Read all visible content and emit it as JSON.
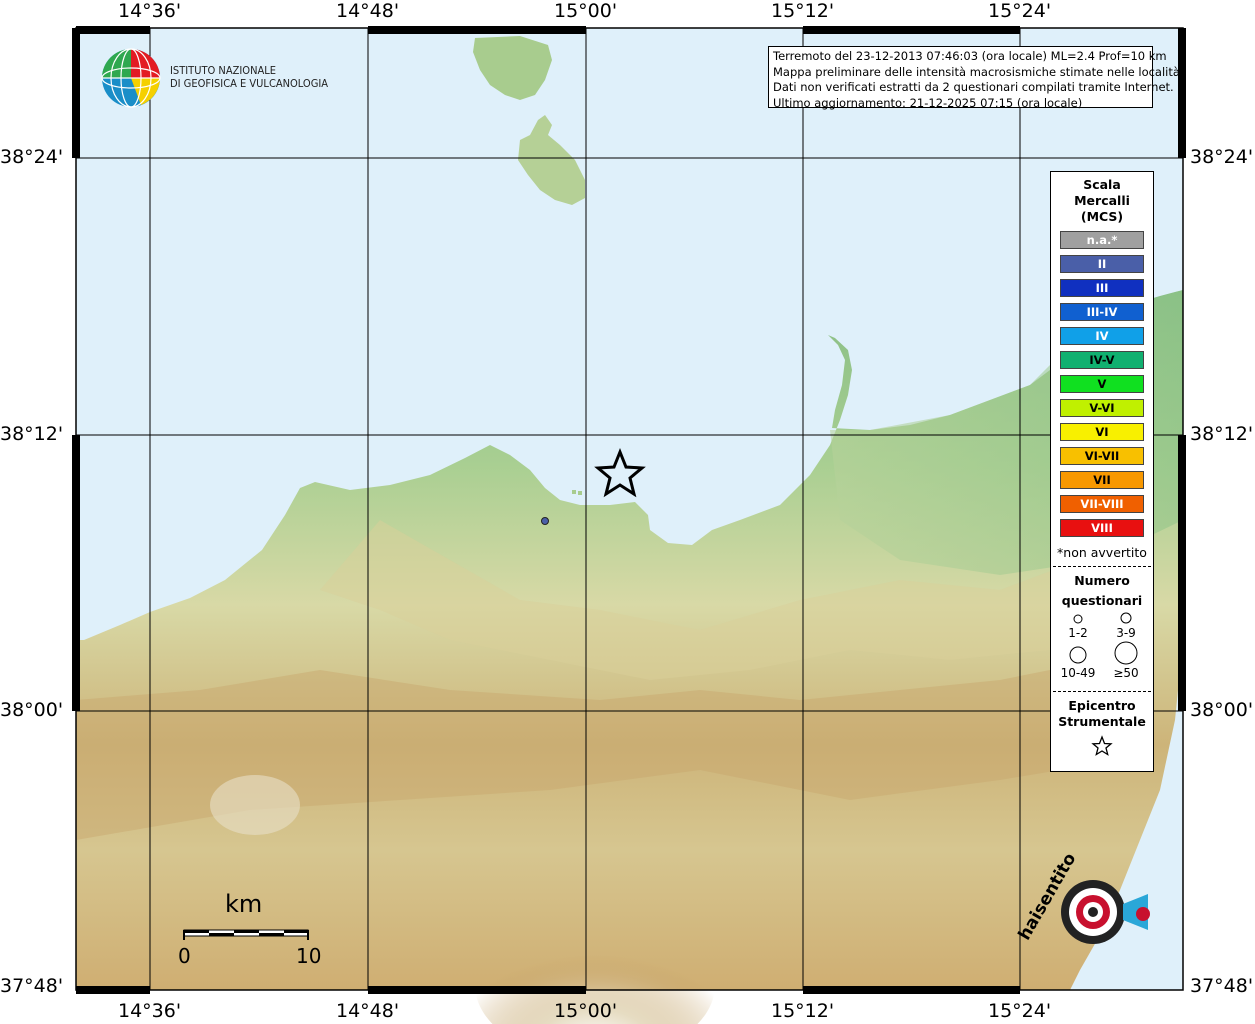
{
  "header_info": {
    "line1": "Terremoto del 23-12-2013 07:46:03 (ora locale) ML=2.4 Prof=10 km",
    "line2": "Mappa preliminare delle intensità macrosismiche stimate nelle località",
    "line3": "Dati non verificati estratti da 2 questionari compilati tramite Internet.",
    "line4": "Ultimo aggiornamento: 21-12-2025 07:15 (ora locale)"
  },
  "institute": {
    "line1": "ISTITUTO NAZIONALE",
    "line2": "DI GEOFISICA E VULCANOLOGIA"
  },
  "axes": {
    "top": [
      "14°36'",
      "14°48'",
      "15°00'",
      "15°12'",
      "15°24'"
    ],
    "bottom": [
      "14°36'",
      "14°48'",
      "15°00'",
      "15°12'",
      "15°24'"
    ],
    "left": [
      "38°24'",
      "38°12'",
      "38°00'",
      "37°48'"
    ],
    "right": [
      "38°24'",
      "38°12'",
      "38°00'",
      "37°48'"
    ]
  },
  "legend": {
    "title1": "Scala",
    "title2": "Mercalli",
    "title3": "(MCS)",
    "classes": [
      {
        "label": "n.a.*",
        "color": "#a0a0a0"
      },
      {
        "label": "II",
        "color": "#4a5fa8"
      },
      {
        "label": "III",
        "color": "#1030c0"
      },
      {
        "label": "III-IV",
        "color": "#1060d0"
      },
      {
        "label": "IV",
        "color": "#10a0e8"
      },
      {
        "label": "IV-V",
        "color": "#10b070"
      },
      {
        "label": "V",
        "color": "#10e020"
      },
      {
        "label": "V-VI",
        "color": "#c0f000"
      },
      {
        "label": "VI",
        "color": "#f8f000"
      },
      {
        "label": "VI-VII",
        "color": "#f8c000"
      },
      {
        "label": "VII",
        "color": "#f89800"
      },
      {
        "label": "VII-VIII",
        "color": "#f06000"
      },
      {
        "label": "VIII",
        "color": "#e81010"
      }
    ],
    "note": "*non avvertito",
    "count_title1": "Numero",
    "count_title2": "questionari",
    "counts": [
      "1-2",
      "3-9",
      "10-49",
      "≥50"
    ],
    "epicenter_title1": "Epicentro",
    "epicenter_title2": "Strumentale"
  },
  "scalebar": {
    "unit": "km",
    "min": "0",
    "max": "10"
  },
  "observations": [
    {
      "lon": 14.947,
      "lat": 38.136,
      "intensity": "II",
      "count_class": "1-2"
    }
  ],
  "epicenter": {
    "lon": 15.028,
    "lat": 38.171
  },
  "brand_logo": "haisentitoilterremoto.it",
  "colors": {
    "sea": "#dff0fa",
    "lowland": "#8fc28a",
    "hills": "#d9d7a4",
    "mountains": "#c09a5c"
  }
}
